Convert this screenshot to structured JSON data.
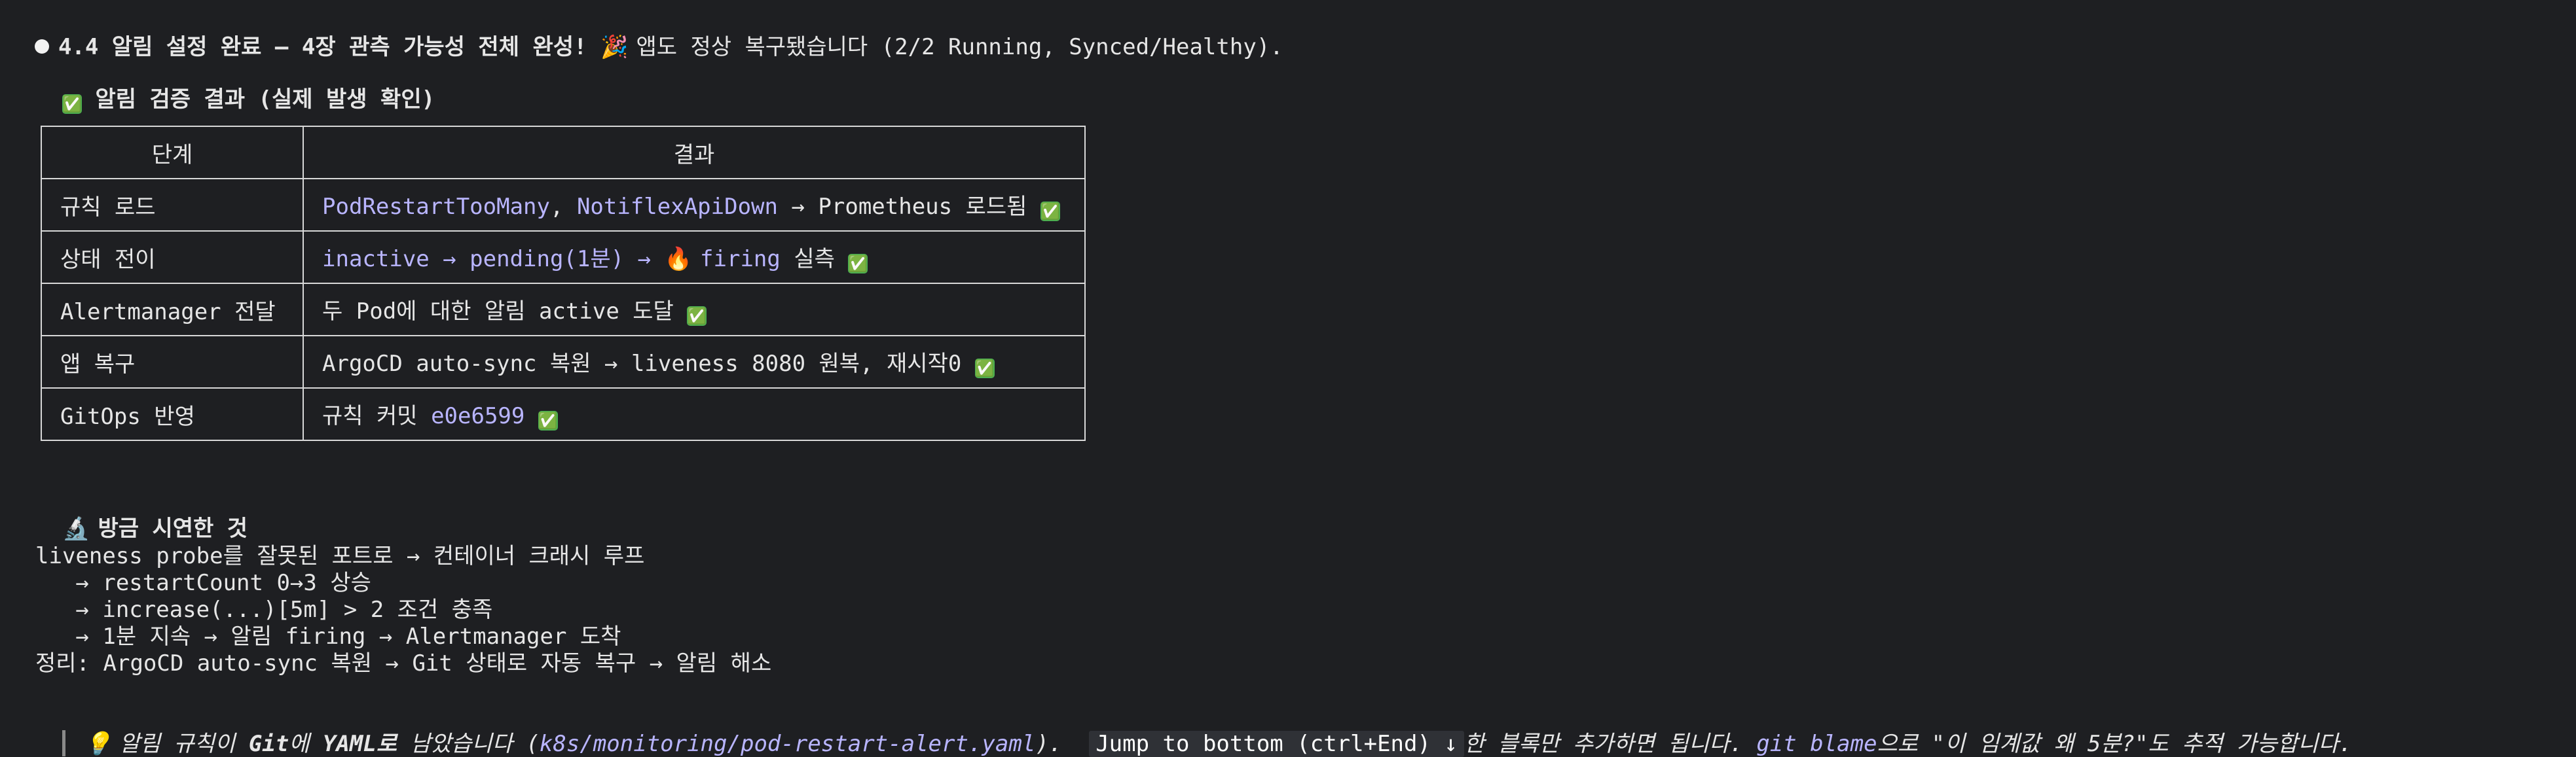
{
  "header": {
    "bullet": "●",
    "title": "4.4 알림 설정 완료 — 4장 관측 가능성 전체 완성!",
    "emoji": "🎉",
    "subtitle": "앱도 정상 복구됐습니다 (2/2 Running, Synced/Healthy)."
  },
  "verification": {
    "check": "✅",
    "heading": "알림 검증 결과 (실제 발생 확인)"
  },
  "table": {
    "headers": [
      "단계",
      "결과"
    ],
    "rows": [
      {
        "stage": "규칙 로드",
        "a": "PodRestartTooMany",
        "b": ", ",
        "c": "NotiflexApiDown",
        "d": " → Prometheus 로드됨 ",
        "e": "✅"
      },
      {
        "stage": "상태 전이",
        "a": "inactive → pending(1분) → ",
        "b": "🔥",
        "c": " firing",
        "d": " 실측 ",
        "e": "✅"
      },
      {
        "stage": "Alertmanager 전달",
        "a": "두 Pod에 대한 알림 active 도달 ",
        "b": "",
        "c": "",
        "d": "",
        "e": "✅"
      },
      {
        "stage": "앱 복구",
        "a": "ArgoCD auto-sync 복원 → liveness 8080 원복, 재시작0 ",
        "b": "",
        "c": "",
        "d": "",
        "e": "✅"
      },
      {
        "stage": "GitOps 반영",
        "a": "규칙 커밋 ",
        "b": "e0e6599",
        "c": " ",
        "d": "",
        "e": "✅"
      }
    ]
  },
  "demo": {
    "icon": "🔬",
    "heading": "방금 시연한 것",
    "lines": [
      "liveness probe를 잘못된 포트로 → 컨테이너 크래시 루프",
      "   → restartCount 0→3 상승",
      "   → increase(...)[5m] > 2 조건 충족",
      "   → 1분 지속 → 알림 firing → Alertmanager 도착",
      "정리: ArgoCD auto-sync 복원 → Git 상태로 자동 복구 → 알림 해소"
    ]
  },
  "tip": {
    "icon": "💡",
    "part1": " 알림 규칙이 ",
    "git": "Git",
    "part2": "에 ",
    "yaml": "YAML로",
    "part3": " 남았습니다 (",
    "path": "k8s/monitoring/pod-restart-alert.yaml",
    "part4": ").  ",
    "jump": "Jump to bottom (ctrl+End) ↓",
    "part5": "한 블록만 추가하면 됩니다. ",
    "blame": "git blame",
    "part6": "으로 \"이 임계값 왜 5분?\"도 추적 가능합니다."
  }
}
